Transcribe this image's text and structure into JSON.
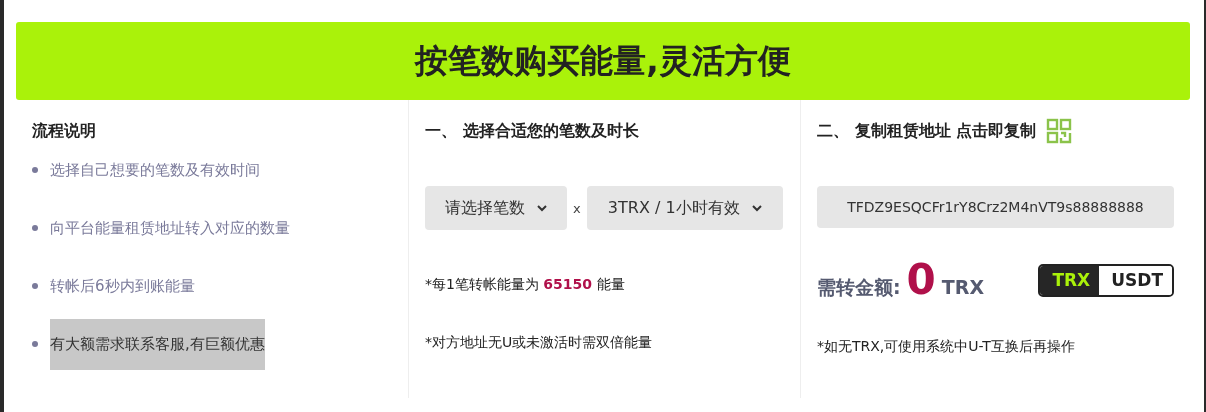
{
  "banner": {
    "title": "按笔数购买能量,灵活方便"
  },
  "steps": {
    "title": "流程说明",
    "items": [
      {
        "text": "选择自己想要的笔数及有效时间",
        "highlighted": false
      },
      {
        "text": "向平台能量租赁地址转入对应的数量",
        "highlighted": false
      },
      {
        "text": "转帐后6秒内到账能量",
        "highlighted": false
      },
      {
        "text": "有大额需求联系客服,有巨额优惠",
        "highlighted": true
      }
    ]
  },
  "choose": {
    "title": "一、 选择合适您的笔数及时长",
    "count_select": "请选择笔数",
    "times": "x",
    "duration_select": "3TRX / 1小时有效",
    "notes": [
      "*每1笔转帐能量为 **65150** 能量",
      "*对方地址无U或未激活时需双倍能量"
    ]
  },
  "copy": {
    "title": "二、 复制租赁地址 点击即复制",
    "address": "TFDZ9ESQCFr1rY8Crz2M4nVT9s88888888",
    "amount_label": "需转金额:",
    "amount": "0",
    "unit": "TRX",
    "currencies": [
      {
        "label": "TRX",
        "selected": true
      },
      {
        "label": "USDT",
        "selected": false
      }
    ],
    "note": "*如无TRX,可使用系统中U-T互换后再操作"
  }
}
